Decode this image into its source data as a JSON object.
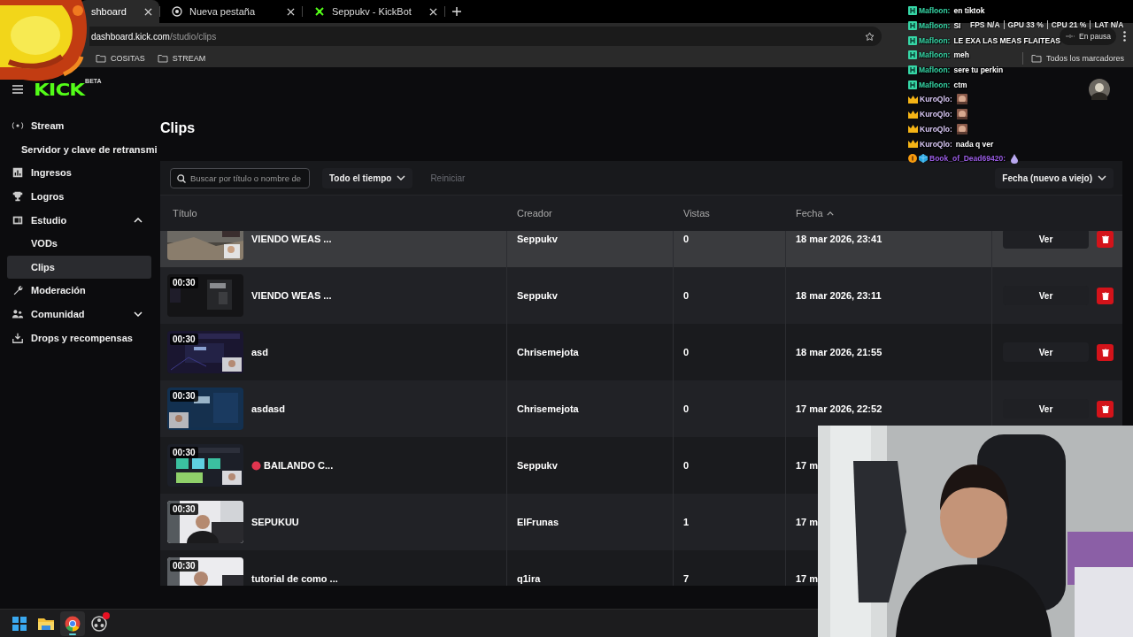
{
  "browser": {
    "tabs": [
      {
        "label": "shboard",
        "selected": true
      },
      {
        "label": "Nueva pestaña",
        "selected": false
      },
      {
        "label": "Seppukv - KickBot",
        "selected": false
      }
    ],
    "address": {
      "host": "dashboard.kick.com",
      "path": "/studio/clips"
    },
    "media_status": "En pausa",
    "bookmarks": [
      "COSITAS",
      "STREAM"
    ],
    "all_bookmarks": "Todos los marcadores"
  },
  "stats": [
    {
      "label": "FPS",
      "value": "N/A"
    },
    {
      "label": "GPU",
      "value": "33 %"
    },
    {
      "label": "CPU",
      "value": "21 %"
    },
    {
      "label": "LAT",
      "value": "N/A"
    }
  ],
  "chat": [
    {
      "user": "Mafloon:",
      "moderator": true,
      "vip": false,
      "subscriber": false,
      "color": "#36d6a6",
      "kind": "text",
      "text": "en tiktok"
    },
    {
      "user": "Mafloon:",
      "moderator": true,
      "vip": false,
      "subscriber": false,
      "color": "#36d6a6",
      "kind": "text",
      "text": "SI"
    },
    {
      "user": "Mafloon:",
      "moderator": true,
      "vip": false,
      "subscriber": false,
      "color": "#36d6a6",
      "kind": "text",
      "text": "LE EXA LAS MEAS FLAITEAS"
    },
    {
      "user": "Mafloon:",
      "moderator": true,
      "vip": false,
      "subscriber": false,
      "color": "#36d6a6",
      "kind": "text",
      "text": "meh"
    },
    {
      "user": "Mafloon:",
      "moderator": true,
      "vip": false,
      "subscriber": false,
      "color": "#36d6a6",
      "kind": "text",
      "text": "sere tu perkin"
    },
    {
      "user": "Mafloon:",
      "moderator": true,
      "vip": false,
      "subscriber": false,
      "color": "#36d6a6",
      "kind": "text",
      "text": "ctm"
    },
    {
      "user": "KuroQlo:",
      "moderator": false,
      "vip": true,
      "subscriber": false,
      "color": "#d9c8f5",
      "kind": "emote"
    },
    {
      "user": "KuroQlo:",
      "moderator": false,
      "vip": true,
      "subscriber": false,
      "color": "#d9c8f5",
      "kind": "emote"
    },
    {
      "user": "KuroQlo:",
      "moderator": false,
      "vip": true,
      "subscriber": false,
      "color": "#d9c8f5",
      "kind": "emote"
    },
    {
      "user": "KuroQlo:",
      "moderator": false,
      "vip": true,
      "subscriber": false,
      "color": "#d9c8f5",
      "kind": "text",
      "text": "nada q ver"
    },
    {
      "user": "Book_of_Dead69420:",
      "moderator": false,
      "vip": false,
      "subscriber": true,
      "color": "#9b5de5",
      "kind": "emoji"
    }
  ],
  "kick": {
    "logo": "KICK",
    "logo_badge": "BETA",
    "sidebar": [
      {
        "label": "Stream",
        "selected": false,
        "children": [
          {
            "label": "Servidor y clave de retransmi",
            "selected": false
          }
        ]
      },
      {
        "label": "Ingresos",
        "selected": false
      },
      {
        "label": "Logros",
        "selected": false
      },
      {
        "label": "Estudio",
        "selected": false,
        "expanded": true,
        "children": [
          {
            "label": "VODs",
            "selected": false
          },
          {
            "label": "Clips",
            "selected": true
          }
        ]
      },
      {
        "label": "Moderación",
        "selected": false
      },
      {
        "label": "Comunidad",
        "selected": false,
        "expanded": false
      },
      {
        "label": "Drops y recompensas",
        "selected": false
      }
    ],
    "page_title": "Clips",
    "search": {
      "placeholder": "Buscar por título o nombre de"
    },
    "period_filter": "Todo el tiempo",
    "reset_button": {
      "label": "Reiniciar",
      "disabled": true
    },
    "sort_menu": "Fecha (nuevo a viejo)",
    "table": {
      "columns": [
        {
          "label": "Título",
          "sorted": false
        },
        {
          "label": "Creador",
          "sorted": false
        },
        {
          "label": "Vistas",
          "sorted": false
        },
        {
          "label": "Fecha",
          "sorted": true
        }
      ],
      "rows": [
        {
          "title": "VIENDO WEAS ...",
          "creator": "Seppukv",
          "views": "0",
          "date": "18 mar 2026, 23:41",
          "action": "Ver",
          "highlighted": true,
          "live_dot": false
        },
        {
          "duration": "00:30",
          "title": "VIENDO WEAS ...",
          "creator": "Seppukv",
          "views": "0",
          "date": "18 mar 2026, 23:11",
          "action": "Ver",
          "highlighted": false,
          "live_dot": false
        },
        {
          "duration": "00:30",
          "title": "asd",
          "creator": "Chrisemejota",
          "views": "0",
          "date": "18 mar 2026, 21:55",
          "action": "Ver",
          "highlighted": false,
          "live_dot": false
        },
        {
          "duration": "00:30",
          "title": "asdasd",
          "creator": "Chrisemejota",
          "views": "0",
          "date": "17 mar 2026, 22:52",
          "action": "Ver",
          "highlighted": false,
          "live_dot": false
        },
        {
          "duration": "00:30",
          "title": "BAILANDO C...",
          "creator": "Seppukv",
          "views": "0",
          "date": "17 m",
          "highlighted": false,
          "live_dot": true
        },
        {
          "duration": "00:30",
          "title": "SEPUKUU",
          "creator": "ElFrunas",
          "views": "1",
          "date": "17 m",
          "highlighted": false,
          "live_dot": false
        },
        {
          "duration": "00:30",
          "title": "tutorial de como ...",
          "creator": "q1ira",
          "views": "7",
          "date": "17 m",
          "highlighted": false,
          "live_dot": false
        }
      ]
    }
  },
  "taskbar": [
    {
      "active": false,
      "alert": false
    },
    {
      "active": false,
      "alert": false
    },
    {
      "active": true,
      "alert": false
    },
    {
      "active": false,
      "alert": true
    }
  ]
}
